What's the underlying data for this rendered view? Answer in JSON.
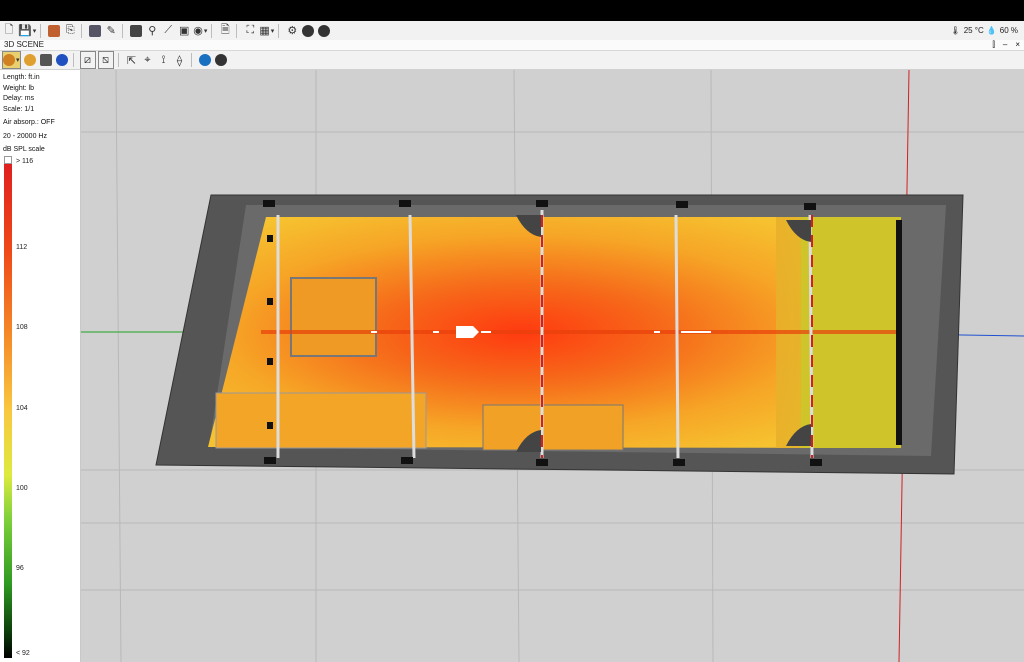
{
  "status": {
    "temperature": "25 °C",
    "humidity": "60 %"
  },
  "scene": {
    "title": "3D SCENE"
  },
  "window_controls": {
    "pin": "⫿",
    "minimize": "–",
    "close": "×"
  },
  "info_panel": {
    "length": "Length: ft.in",
    "weight": "Weight: lb",
    "delay": "Delay: ms",
    "scale": "Scale: 1/1",
    "air": "Air absorp.: OFF",
    "freq": "20 - 20000 Hz",
    "spl_title": "dB SPL scale",
    "spl_top": "> 116",
    "spl_bottom": "< 92",
    "ticks": [
      "112",
      "108",
      "104",
      "100",
      "96"
    ]
  },
  "colors": {
    "accent_axis_red": "#d02020",
    "accent_axis_green": "#20a020",
    "accent_axis_blue": "#2050d0"
  },
  "icons": {
    "toolbar1": [
      "new-file-icon",
      "save-icon",
      "open-model-icon",
      "attach-icon",
      "render-icon",
      "pencil-icon",
      "box-icon",
      "speaker-icon",
      "graph-icon",
      "image-icon",
      "camera-icon",
      "report-icon",
      "fit-view-icon",
      "grid-icon",
      "settings-icon",
      "help-icon",
      "more-icon"
    ],
    "toolbar2": [
      "view-mode-icon",
      "rotate-icon",
      "solid-icon",
      "color-map-icon",
      "wireframe-icon",
      "measure-icon",
      "export-icon",
      "probe-icon",
      "aim-icon",
      "align-icon",
      "info-icon",
      "help-icon"
    ]
  }
}
